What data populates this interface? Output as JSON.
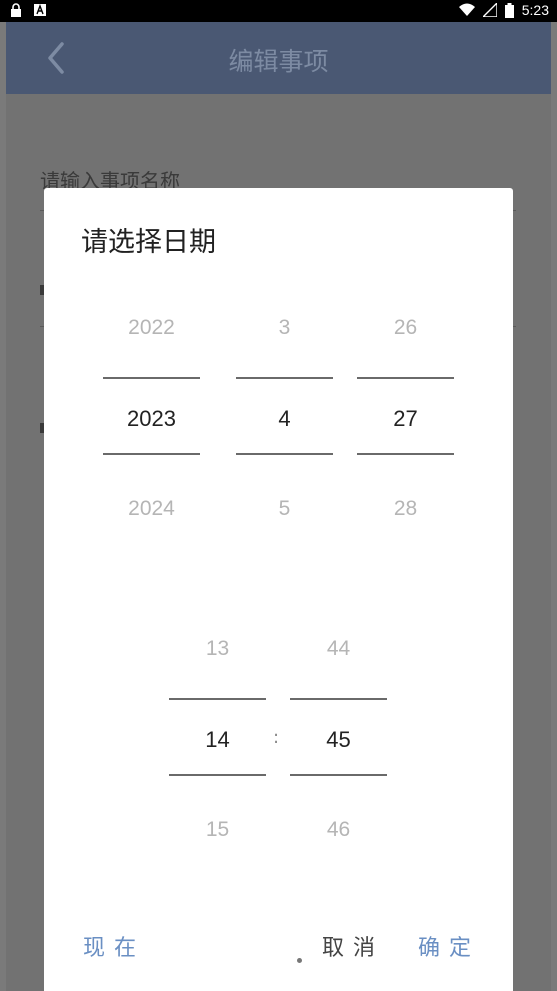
{
  "status_bar": {
    "time": "5:23"
  },
  "app_bar": {
    "title": "编辑事项"
  },
  "background_form": {
    "name_placeholder": "请输入事项名称"
  },
  "dialog": {
    "title": "请选择日期",
    "year": {
      "prev": "2022",
      "selected": "2023",
      "next": "2024"
    },
    "month": {
      "prev": "3",
      "selected": "4",
      "next": "5"
    },
    "day": {
      "prev": "26",
      "selected": "27",
      "next": "28"
    },
    "hour": {
      "prev": "13",
      "selected": "14",
      "next": "15"
    },
    "minute": {
      "prev": "44",
      "selected": "45",
      "next": "46"
    },
    "time_separator": ":",
    "now_button": "现在",
    "cancel_button": "取消",
    "confirm_button": "确定"
  },
  "colors": {
    "accent": "#6a8fc3",
    "app_bar": "#4a5873"
  }
}
